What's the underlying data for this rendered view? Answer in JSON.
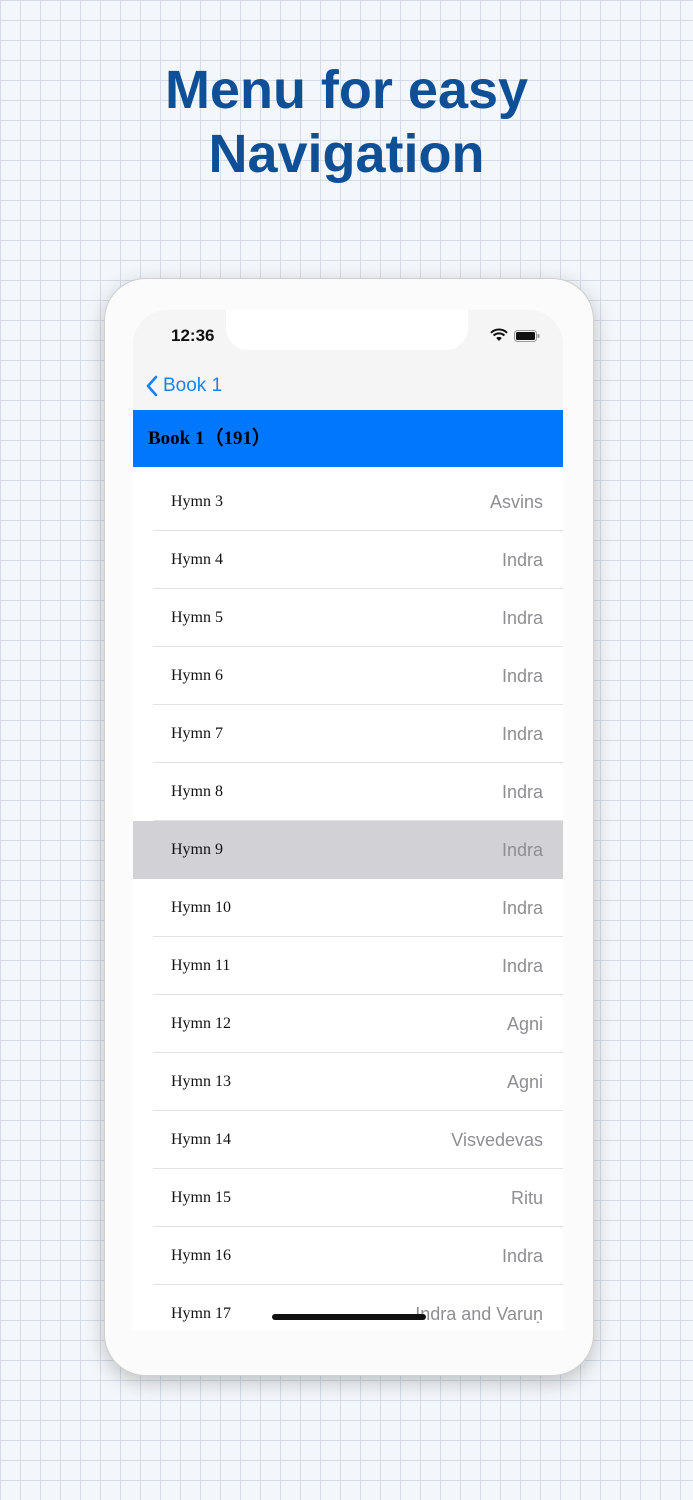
{
  "headline": {
    "line1": "Menu for easy",
    "line2": "Navigation"
  },
  "status_bar": {
    "time": "12:36"
  },
  "nav": {
    "back_label": "Book 1"
  },
  "section": {
    "title": "Book 1（191）"
  },
  "rows": [
    {
      "title": "Hymn 3",
      "subtitle": "Asvins"
    },
    {
      "title": "Hymn 4",
      "subtitle": "Indra"
    },
    {
      "title": "Hymn 5",
      "subtitle": "Indra"
    },
    {
      "title": "Hymn 6",
      "subtitle": "Indra"
    },
    {
      "title": "Hymn 7",
      "subtitle": "Indra"
    },
    {
      "title": "Hymn 8",
      "subtitle": "Indra"
    },
    {
      "title": "Hymn 9",
      "subtitle": "Indra",
      "selected": true
    },
    {
      "title": "Hymn 10",
      "subtitle": "Indra"
    },
    {
      "title": "Hymn 11",
      "subtitle": "Indra"
    },
    {
      "title": "Hymn 12",
      "subtitle": "Agni"
    },
    {
      "title": "Hymn 13",
      "subtitle": "Agni"
    },
    {
      "title": "Hymn 14",
      "subtitle": "Visvedevas"
    },
    {
      "title": "Hymn 15",
      "subtitle": "Ritu"
    },
    {
      "title": "Hymn 16",
      "subtitle": "Indra"
    },
    {
      "title": "Hymn 17",
      "subtitle": "Indra and Varuṇ"
    }
  ],
  "colors": {
    "headline": "#0e4f96",
    "accent": "#0077fd",
    "back_link": "#1a82f0",
    "selected_row": "#d1d1d6",
    "subtitle": "#8e8e93"
  },
  "icons": [
    "chevron-left-icon",
    "signal-icon",
    "wifi-icon",
    "battery-icon"
  ]
}
